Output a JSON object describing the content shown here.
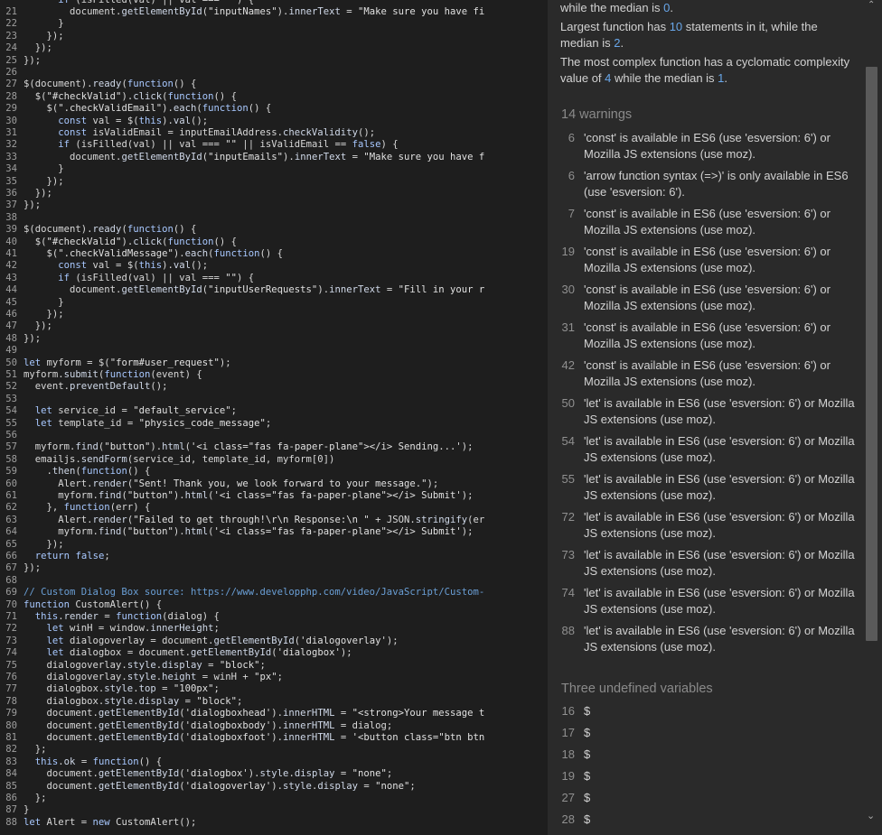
{
  "code_lines": [
    {
      "n": "",
      "t": "      if (isFilled(val) || val === \"\") {"
    },
    {
      "n": "21",
      "t": "        document.getElementById(\"inputNames\").innerText = \"Make sure you have fi"
    },
    {
      "n": "22",
      "t": "      }"
    },
    {
      "n": "23",
      "t": "    });"
    },
    {
      "n": "24",
      "t": "  });"
    },
    {
      "n": "25",
      "t": "});"
    },
    {
      "n": "26",
      "t": ""
    },
    {
      "n": "27",
      "t": "$(document).ready(function() {"
    },
    {
      "n": "28",
      "t": "  $(\"#checkValid\").click(function() {"
    },
    {
      "n": "29",
      "t": "    $(\".checkValidEmail\").each(function() {"
    },
    {
      "n": "30",
      "t": "      const val = $(this).val();"
    },
    {
      "n": "31",
      "t": "      const isValidEmail = inputEmailAddress.checkValidity();"
    },
    {
      "n": "32",
      "t": "      if (isFilled(val) || val === \"\" || isValidEmail == false) {"
    },
    {
      "n": "33",
      "t": "        document.getElementById(\"inputEmails\").innerText = \"Make sure you have f"
    },
    {
      "n": "34",
      "t": "      }"
    },
    {
      "n": "35",
      "t": "    });"
    },
    {
      "n": "36",
      "t": "  });"
    },
    {
      "n": "37",
      "t": "});"
    },
    {
      "n": "38",
      "t": ""
    },
    {
      "n": "39",
      "t": "$(document).ready(function() {"
    },
    {
      "n": "40",
      "t": "  $(\"#checkValid\").click(function() {"
    },
    {
      "n": "41",
      "t": "    $(\".checkValidMessage\").each(function() {"
    },
    {
      "n": "42",
      "t": "      const val = $(this).val();"
    },
    {
      "n": "43",
      "t": "      if (isFilled(val) || val === \"\") {"
    },
    {
      "n": "44",
      "t": "        document.getElementById(\"inputUserRequests\").innerText = \"Fill in your r"
    },
    {
      "n": "45",
      "t": "      }"
    },
    {
      "n": "46",
      "t": "    });"
    },
    {
      "n": "47",
      "t": "  });"
    },
    {
      "n": "48",
      "t": "});"
    },
    {
      "n": "49",
      "t": ""
    },
    {
      "n": "50",
      "t": "let myform = $(\"form#user_request\");"
    },
    {
      "n": "51",
      "t": "myform.submit(function(event) {"
    },
    {
      "n": "52",
      "t": "  event.preventDefault();"
    },
    {
      "n": "53",
      "t": ""
    },
    {
      "n": "54",
      "t": "  let service_id = \"default_service\";"
    },
    {
      "n": "55",
      "t": "  let template_id = \"physics_code_message\";"
    },
    {
      "n": "56",
      "t": ""
    },
    {
      "n": "57",
      "t": "  myform.find(\"button\").html('<i class=\"fas fa-paper-plane\"></i> Sending...');"
    },
    {
      "n": "58",
      "t": "  emailjs.sendForm(service_id, template_id, myform[0])"
    },
    {
      "n": "59",
      "t": "    .then(function() {"
    },
    {
      "n": "60",
      "t": "      Alert.render(\"Sent! Thank you, we look forward to your message.\");"
    },
    {
      "n": "61",
      "t": "      myform.find(\"button\").html('<i class=\"fas fa-paper-plane\"></i> Submit');"
    },
    {
      "n": "62",
      "t": "    }, function(err) {"
    },
    {
      "n": "63",
      "t": "      Alert.render(\"Failed to get through!\\r\\n Response:\\n \" + JSON.stringify(er"
    },
    {
      "n": "64",
      "t": "      myform.find(\"button\").html('<i class=\"fas fa-paper-plane\"></i> Submit');"
    },
    {
      "n": "65",
      "t": "    });"
    },
    {
      "n": "66",
      "t": "  return false;"
    },
    {
      "n": "67",
      "t": "});"
    },
    {
      "n": "68",
      "t": ""
    },
    {
      "n": "69",
      "t": "// Custom Dialog Box source: https://www.developphp.com/video/JavaScript/Custom-"
    },
    {
      "n": "70",
      "t": "function CustomAlert() {"
    },
    {
      "n": "71",
      "t": "  this.render = function(dialog) {"
    },
    {
      "n": "72",
      "t": "    let winH = window.innerHeight;"
    },
    {
      "n": "73",
      "t": "    let dialogoverlay = document.getElementById('dialogoverlay');"
    },
    {
      "n": "74",
      "t": "    let dialogbox = document.getElementById('dialogbox');"
    },
    {
      "n": "75",
      "t": "    dialogoverlay.style.display = \"block\";"
    },
    {
      "n": "76",
      "t": "    dialogoverlay.style.height = winH + \"px\";"
    },
    {
      "n": "77",
      "t": "    dialogbox.style.top = \"100px\";"
    },
    {
      "n": "78",
      "t": "    dialogbox.style.display = \"block\";"
    },
    {
      "n": "79",
      "t": "    document.getElementById('dialogboxhead').innerHTML = \"<strong>Your message t"
    },
    {
      "n": "80",
      "t": "    document.getElementById('dialogboxbody').innerHTML = dialog;"
    },
    {
      "n": "81",
      "t": "    document.getElementById('dialogboxfoot').innerHTML = '<button class=\"btn btn"
    },
    {
      "n": "82",
      "t": "  };"
    },
    {
      "n": "83",
      "t": "  this.ok = function() {"
    },
    {
      "n": "84",
      "t": "    document.getElementById('dialogbox').style.display = \"none\";"
    },
    {
      "n": "85",
      "t": "    document.getElementById('dialogoverlay').style.display = \"none\";"
    },
    {
      "n": "86",
      "t": "  };"
    },
    {
      "n": "87",
      "t": "}"
    },
    {
      "n": "88",
      "t": "let Alert = new CustomAlert();"
    }
  ],
  "metrics": {
    "line1_prefix": "while the median is ",
    "line1_value": "0",
    "line1_suffix": ".",
    "line2_prefix": "Largest function has ",
    "line2_value": "10",
    "line2_suffix": " statements in it, while the",
    "line3_prefix": "median is ",
    "line3_value": "2",
    "line3_suffix": ".",
    "line4": "The most complex function has a cyclomatic complexity",
    "line5_prefix": "value of ",
    "line5_value": "4",
    "line5_mid": " while the median is ",
    "line5_value2": "1",
    "line5_suffix": "."
  },
  "warnings": {
    "title": "14 warnings",
    "items": [
      {
        "line": "6",
        "msg": "'const' is available in ES6 (use 'esversion: 6') or Mozilla JS extensions (use moz)."
      },
      {
        "line": "6",
        "msg": "'arrow function syntax (=>)' is only available in ES6 (use 'esversion: 6')."
      },
      {
        "line": "7",
        "msg": "'const' is available in ES6 (use 'esversion: 6') or Mozilla JS extensions (use moz)."
      },
      {
        "line": "19",
        "msg": "'const' is available in ES6 (use 'esversion: 6') or Mozilla JS extensions (use moz)."
      },
      {
        "line": "30",
        "msg": "'const' is available in ES6 (use 'esversion: 6') or Mozilla JS extensions (use moz)."
      },
      {
        "line": "31",
        "msg": "'const' is available in ES6 (use 'esversion: 6') or Mozilla JS extensions (use moz)."
      },
      {
        "line": "42",
        "msg": "'const' is available in ES6 (use 'esversion: 6') or Mozilla JS extensions (use moz)."
      },
      {
        "line": "50",
        "msg": "'let' is available in ES6 (use 'esversion: 6') or Mozilla JS extensions (use moz)."
      },
      {
        "line": "54",
        "msg": "'let' is available in ES6 (use 'esversion: 6') or Mozilla JS extensions (use moz)."
      },
      {
        "line": "55",
        "msg": "'let' is available in ES6 (use 'esversion: 6') or Mozilla JS extensions (use moz)."
      },
      {
        "line": "72",
        "msg": "'let' is available in ES6 (use 'esversion: 6') or Mozilla JS extensions (use moz)."
      },
      {
        "line": "73",
        "msg": "'let' is available in ES6 (use 'esversion: 6') or Mozilla JS extensions (use moz)."
      },
      {
        "line": "74",
        "msg": "'let' is available in ES6 (use 'esversion: 6') or Mozilla JS extensions (use moz)."
      },
      {
        "line": "88",
        "msg": "'let' is available in ES6 (use 'esversion: 6') or Mozilla JS extensions (use moz)."
      }
    ]
  },
  "undefined_vars": {
    "title": "Three undefined variables",
    "items": [
      {
        "line": "16",
        "name": "$"
      },
      {
        "line": "17",
        "name": "$"
      },
      {
        "line": "18",
        "name": "$"
      },
      {
        "line": "19",
        "name": "$"
      },
      {
        "line": "27",
        "name": "$"
      },
      {
        "line": "28",
        "name": "$"
      }
    ]
  },
  "scrollbar": {
    "up_glyph": "⌃",
    "down_glyph": "⌄"
  }
}
